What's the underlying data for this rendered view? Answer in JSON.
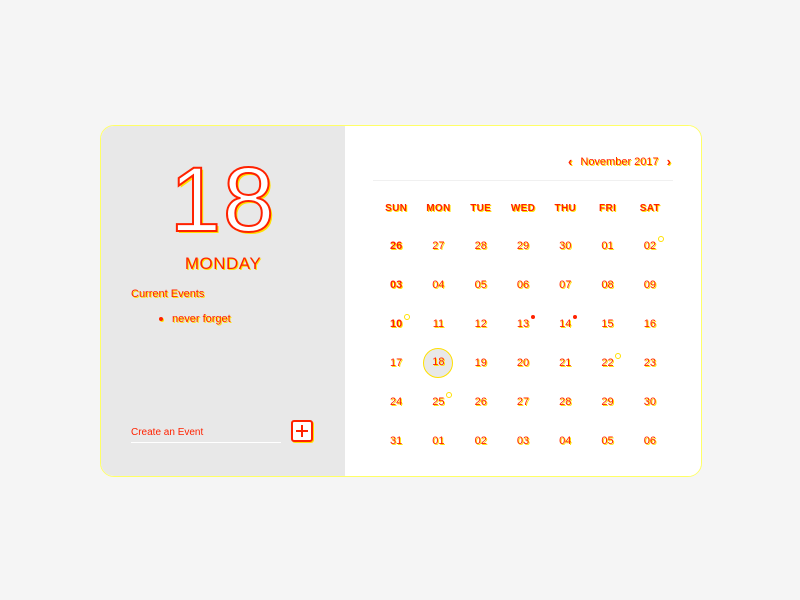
{
  "panel": {
    "day_number": "18",
    "weekday": "MONDAY",
    "events_heading": "Current Events",
    "events": [
      "never forget"
    ],
    "create_placeholder": "Create an Event"
  },
  "calendar": {
    "month_label": "November 2017",
    "weekdays": [
      "SUN",
      "MON",
      "TUE",
      "WED",
      "THU",
      "FRI",
      "SAT"
    ],
    "weeks": [
      [
        {
          "d": "26",
          "bold": true
        },
        {
          "d": "27"
        },
        {
          "d": "28"
        },
        {
          "d": "29"
        },
        {
          "d": "30"
        },
        {
          "d": "01"
        },
        {
          "d": "02",
          "mark": "ring"
        }
      ],
      [
        {
          "d": "03",
          "bold": true
        },
        {
          "d": "04"
        },
        {
          "d": "05"
        },
        {
          "d": "06"
        },
        {
          "d": "07"
        },
        {
          "d": "08"
        },
        {
          "d": "09"
        }
      ],
      [
        {
          "d": "10",
          "bold": true,
          "mark": "ring"
        },
        {
          "d": "11"
        },
        {
          "d": "12"
        },
        {
          "d": "13",
          "mark": "dot"
        },
        {
          "d": "14",
          "mark": "dot"
        },
        {
          "d": "15"
        },
        {
          "d": "16"
        }
      ],
      [
        {
          "d": "17"
        },
        {
          "d": "18",
          "selected": true
        },
        {
          "d": "19"
        },
        {
          "d": "20"
        },
        {
          "d": "21"
        },
        {
          "d": "22",
          "mark": "ring"
        },
        {
          "d": "23"
        }
      ],
      [
        {
          "d": "24"
        },
        {
          "d": "25",
          "mark": "ring"
        },
        {
          "d": "26"
        },
        {
          "d": "27"
        },
        {
          "d": "28"
        },
        {
          "d": "29"
        },
        {
          "d": "30"
        }
      ],
      [
        {
          "d": "31"
        },
        {
          "d": "01"
        },
        {
          "d": "02"
        },
        {
          "d": "03"
        },
        {
          "d": "04"
        },
        {
          "d": "05"
        },
        {
          "d": "06"
        }
      ]
    ]
  },
  "icons": {
    "prev": "chevron-left-icon",
    "next": "chevron-right-icon",
    "add": "plus-icon"
  },
  "colors": {
    "accent": "#ff2200",
    "highlight": "#ffe000",
    "panel_bg": "#e8e8e8",
    "page_bg": "#f5f5f5"
  }
}
